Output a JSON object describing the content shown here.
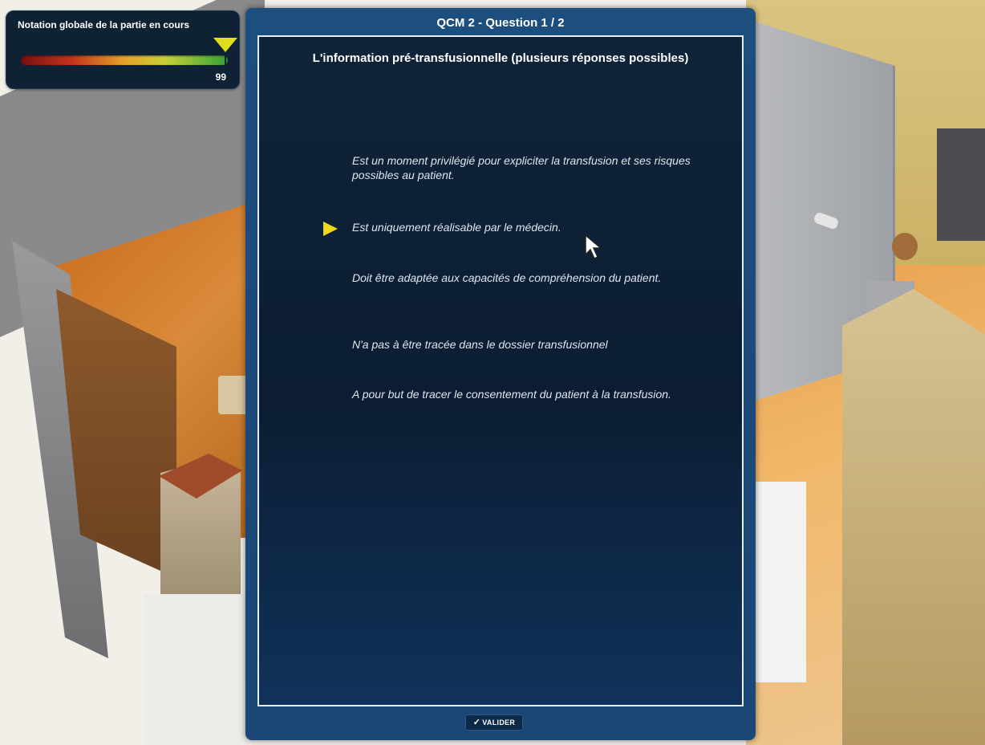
{
  "hud": {
    "score_title": "Notation globale de la partie en cours",
    "score_value": "99",
    "score_level": 0.99,
    "marker_color": "#dede1e"
  },
  "dialog": {
    "title": "QCM 2 - Question 1 / 2",
    "question": "L'information pré-transfusionnelle (plusieurs réponses possibles)",
    "options": [
      {
        "text": "Est un moment privilégié pour expliciter la transfusion et ses risques possibles au patient.",
        "selected": false
      },
      {
        "text": "Est uniquement réalisable par le médecin.",
        "selected": true
      },
      {
        "text": "Doit être adaptée aux capacités de compréhension du patient.",
        "selected": false
      },
      {
        "text": "N'a pas à être tracée dans le dossier transfusionnel",
        "selected": false
      },
      {
        "text": "A pour but de tracer le consentement du patient à la transfusion.",
        "selected": false
      }
    ],
    "validate_label": "VALIDER",
    "validate_icon": "checkmark-icon"
  },
  "colors": {
    "dialog_frame": "#1c4e7e",
    "dialog_inner": "#0c1d33",
    "selection_arrow": "#ecd91e",
    "option_text": "#dfe6ee"
  }
}
